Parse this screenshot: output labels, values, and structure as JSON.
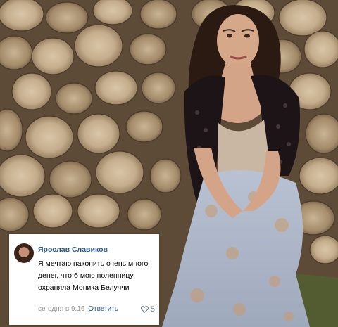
{
  "colors": {
    "author": "#2a5885",
    "meta": "#939393",
    "card": "#ffffff"
  },
  "comment": {
    "author": "Ярослав Славиков",
    "text": "Я мечтаю накопить очень много денег, что б мою поленницу охраняла Моника Белуччи",
    "time": "сегодня в 9:16",
    "reply_label": "Ответить",
    "likes": "5",
    "like_icon": "heart-icon",
    "avatar_icon": "user-avatar"
  }
}
